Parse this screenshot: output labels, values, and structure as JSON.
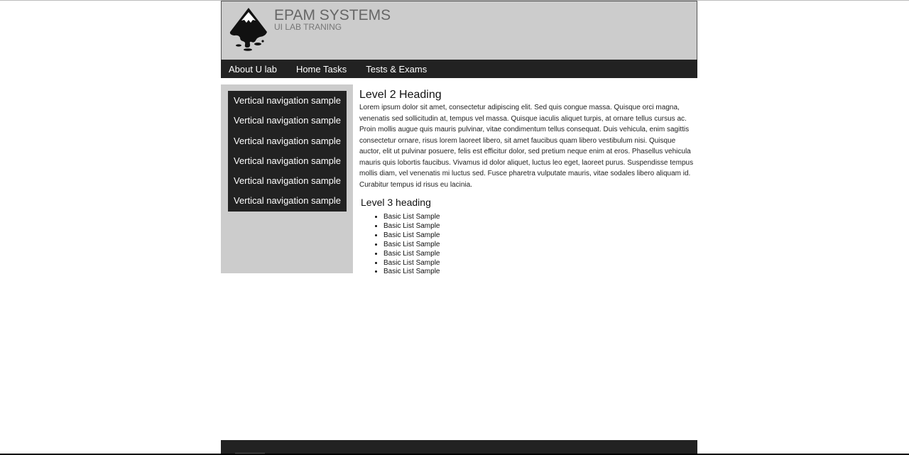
{
  "header": {
    "logo_icon": "inkscape-logo-icon",
    "title": "EPAM SYSTEMS",
    "subtitle": "UI LAB TRANING"
  },
  "topnav": {
    "items": [
      {
        "label": "About U lab"
      },
      {
        "label": "Home Tasks"
      },
      {
        "label": "Tests & Exams"
      }
    ]
  },
  "sidebar": {
    "items": [
      {
        "label": "Vertical navigation sample"
      },
      {
        "label": "Vertical navigation sample"
      },
      {
        "label": "Vertical navigation sample"
      },
      {
        "label": "Vertical navigation sample"
      },
      {
        "label": "Vertical navigation sample"
      },
      {
        "label": "Vertical navigation sample"
      }
    ]
  },
  "main": {
    "h2": "Level 2 Heading",
    "paragraph": "Lorem ipsum dolor sit amet, consectetur adipiscing elit. Sed quis congue massa. Quisque orci magna,\nvenenatis sed sollicitudin at, tempus vel massa. Quisque iaculis aliquet turpis, at ornare tellus cursus ac.\nProin mollis augue quis mauris pulvinar, vitae condimentum tellus consequat. Duis vehicula, enim sagittis\nconsectetur ornare, risus lorem laoreet libero, sit amet faucibus quam libero vestibulum nisi. Quisque\nauctor, elit ut pulvinar posuere, felis est efficitur dolor, sed pretium neque enim at eros. Phasellus vehicula\nmauris quis lobortis faucibus. Vivamus id dolor aliquet, luctus leo eget, laoreet purus. Suspendisse tempus\nmollis diam, vel venenatis mi luctus sed. Fusce pharetra vulputate mauris, vitae sodales libero aliquam id.\nCurabitur tempus id risus eu lacinia.",
    "h3": "Level 3 heading",
    "list": [
      "Basic List Sample",
      "Basic List Sample",
      "Basic List Sample",
      "Basic List Sample",
      "Basic List Sample",
      "Basic List Sample",
      "Basic List Sample"
    ]
  },
  "colors": {
    "header_bg": "#cccccc",
    "nav_bg": "#222222",
    "nav_text": "#ffffff",
    "title_text": "#666666"
  }
}
